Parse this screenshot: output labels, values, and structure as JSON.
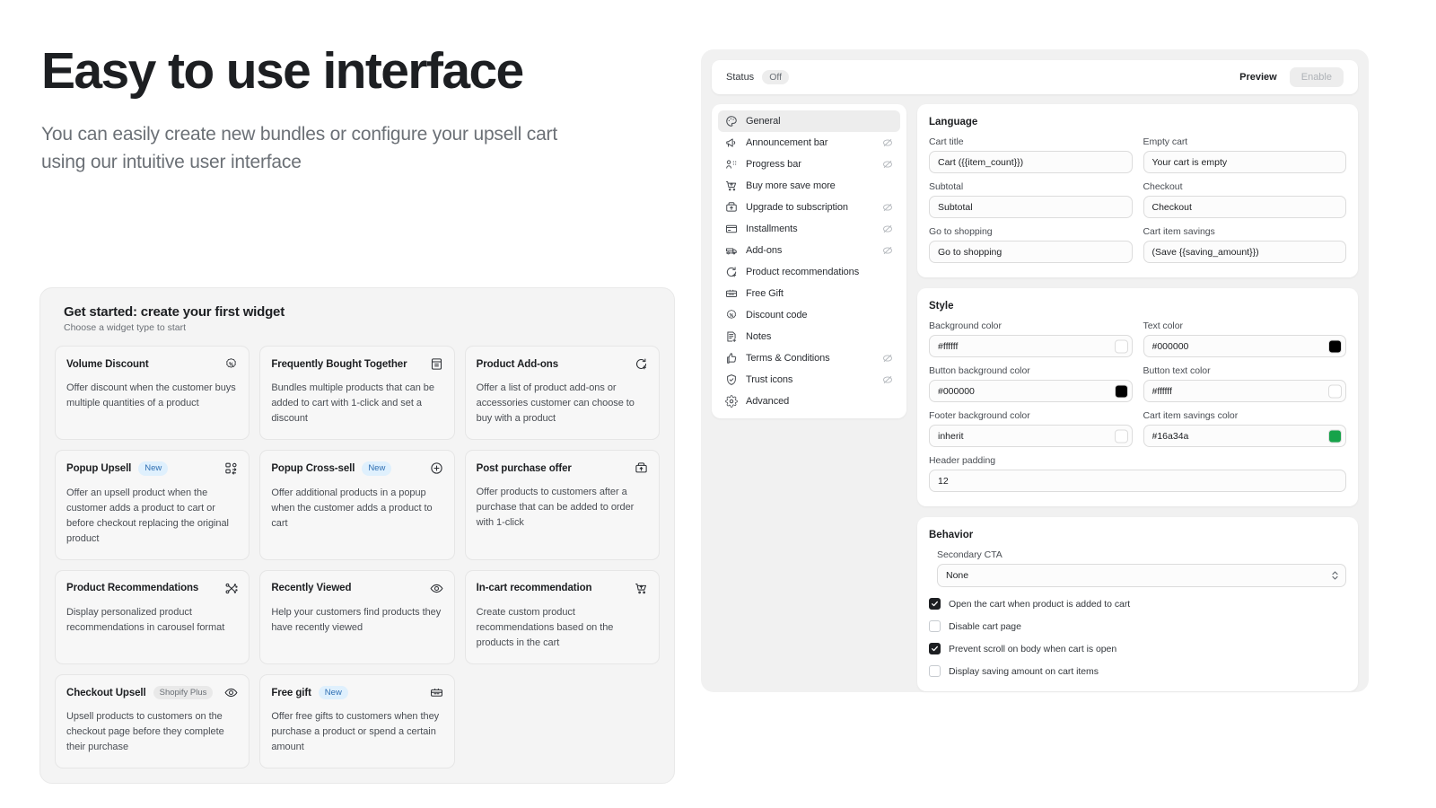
{
  "hero": {
    "title": "Easy to use interface",
    "subtitle": "You can easily create new bundles or configure your upsell cart using our intuitive user interface"
  },
  "get_started": {
    "title": "Get started: create your first widget",
    "subtitle": "Choose a widget type to start",
    "widgets": [
      {
        "title": "Volume Discount",
        "badge": null,
        "badge_type": null,
        "icon": "discount-badge-icon",
        "desc": "Offer discount when the customer buys multiple quantities of a product"
      },
      {
        "title": "Frequently Bought Together",
        "badge": null,
        "badge_type": null,
        "icon": "archive-box-icon",
        "desc": "Bundles multiple products that can be added to cart with 1-click and set a discount"
      },
      {
        "title": "Product Add-ons",
        "badge": null,
        "badge_type": null,
        "icon": "add-product-icon",
        "desc": "Offer a list of product add-ons or accessories customer can choose to buy with a product"
      },
      {
        "title": "Popup Upsell",
        "badge": "New",
        "badge_type": "new",
        "icon": "popup-upsell-icon",
        "desc": "Offer an upsell product when the customer adds a product to cart or before checkout replacing the original product"
      },
      {
        "title": "Popup Cross-sell",
        "badge": "New",
        "badge_type": "new",
        "icon": "plus-circle-icon",
        "desc": "Offer additional products in a popup when the customer adds a product to cart"
      },
      {
        "title": "Post purchase offer",
        "badge": null,
        "badge_type": null,
        "icon": "upgrade-subscription-icon",
        "desc": "Offer products to customers after a purchase that can be added to order with 1-click"
      },
      {
        "title": "Product Recommendations",
        "badge": null,
        "badge_type": null,
        "icon": "recommendations-icon",
        "desc": "Display personalized product recommendations in carousel format"
      },
      {
        "title": "Recently Viewed",
        "badge": null,
        "badge_type": null,
        "icon": "eye-icon",
        "desc": "Help your customers find products they have recently viewed"
      },
      {
        "title": "In-cart recommendation",
        "badge": null,
        "badge_type": null,
        "icon": "cart-up-icon",
        "desc": "Create custom product recommendations based on the products in the cart"
      },
      {
        "title": "Checkout Upsell",
        "badge": "Shopify Plus",
        "badge_type": "plus",
        "icon": "eye-icon",
        "desc": "Upsell products to customers on the checkout page before they complete their purchase"
      },
      {
        "title": "Free gift",
        "badge": "New",
        "badge_type": "new",
        "icon": "gift-icon",
        "desc": "Offer free gifts to customers when they purchase a product or spend a certain amount"
      }
    ]
  },
  "editor": {
    "topbar": {
      "status_label": "Status",
      "status_value": "Off",
      "preview_label": "Preview",
      "enable_label": "Enable"
    },
    "nav": [
      {
        "label": "General",
        "icon": "palette-icon",
        "active": true,
        "hidden": false
      },
      {
        "label": "Announcement bar",
        "icon": "megaphone-icon",
        "active": false,
        "hidden": true
      },
      {
        "label": "Progress bar",
        "icon": "progress-icon",
        "active": false,
        "hidden": true
      },
      {
        "label": "Buy more save more",
        "icon": "cart-up-icon",
        "active": false,
        "hidden": false
      },
      {
        "label": "Upgrade to subscription",
        "icon": "upgrade-subscription-icon",
        "active": false,
        "hidden": true
      },
      {
        "label": "Installments",
        "icon": "credit-card-icon",
        "active": false,
        "hidden": true
      },
      {
        "label": "Add-ons",
        "icon": "addons-icon",
        "active": false,
        "hidden": true
      },
      {
        "label": "Product recommendations",
        "icon": "add-product-icon",
        "active": false,
        "hidden": false
      },
      {
        "label": "Free Gift",
        "icon": "gift-icon",
        "active": false,
        "hidden": false
      },
      {
        "label": "Discount code",
        "icon": "discount-badge-icon",
        "active": false,
        "hidden": false
      },
      {
        "label": "Notes",
        "icon": "note-add-icon",
        "active": false,
        "hidden": false
      },
      {
        "label": "Terms & Conditions",
        "icon": "thumbs-up-icon",
        "active": false,
        "hidden": true
      },
      {
        "label": "Trust icons",
        "icon": "shield-check-icon",
        "active": false,
        "hidden": true
      },
      {
        "label": "Advanced",
        "icon": "gear-icon",
        "active": false,
        "hidden": false
      }
    ],
    "language": {
      "title": "Language",
      "fields": [
        {
          "label": "Cart title",
          "value": "Cart ({{item_count}})"
        },
        {
          "label": "Empty cart",
          "value": "Your cart is empty"
        },
        {
          "label": "Subtotal",
          "value": "Subtotal"
        },
        {
          "label": "Checkout",
          "value": "Checkout"
        },
        {
          "label": "Go to shopping",
          "value": "Go to shopping"
        },
        {
          "label": "Cart item savings",
          "value": "(Save {{saving_amount}})"
        }
      ]
    },
    "style": {
      "title": "Style",
      "fields": [
        {
          "label": "Background color",
          "value": "#ffffff",
          "swatch": "#ffffff"
        },
        {
          "label": "Text color",
          "value": "#000000",
          "swatch": "#000000"
        },
        {
          "label": "Button background color",
          "value": "#000000",
          "swatch": "#000000"
        },
        {
          "label": "Button text color",
          "value": "#ffffff",
          "swatch": "#ffffff"
        },
        {
          "label": "Footer background color",
          "value": "inherit",
          "swatch": "#ffffff"
        },
        {
          "label": "Cart item savings color",
          "value": "#16a34a",
          "swatch": "#16a34a"
        }
      ],
      "header_padding": {
        "label": "Header padding",
        "value": "12"
      }
    },
    "behavior": {
      "title": "Behavior",
      "secondary_cta": {
        "label": "Secondary CTA",
        "value": "None",
        "options": [
          "None"
        ]
      },
      "checkboxes": [
        {
          "label": "Open the cart when product is added to cart",
          "checked": true
        },
        {
          "label": "Disable cart page",
          "checked": false
        },
        {
          "label": "Prevent scroll on body when cart is open",
          "checked": true
        },
        {
          "label": "Display saving amount on cart items",
          "checked": false
        }
      ]
    }
  }
}
